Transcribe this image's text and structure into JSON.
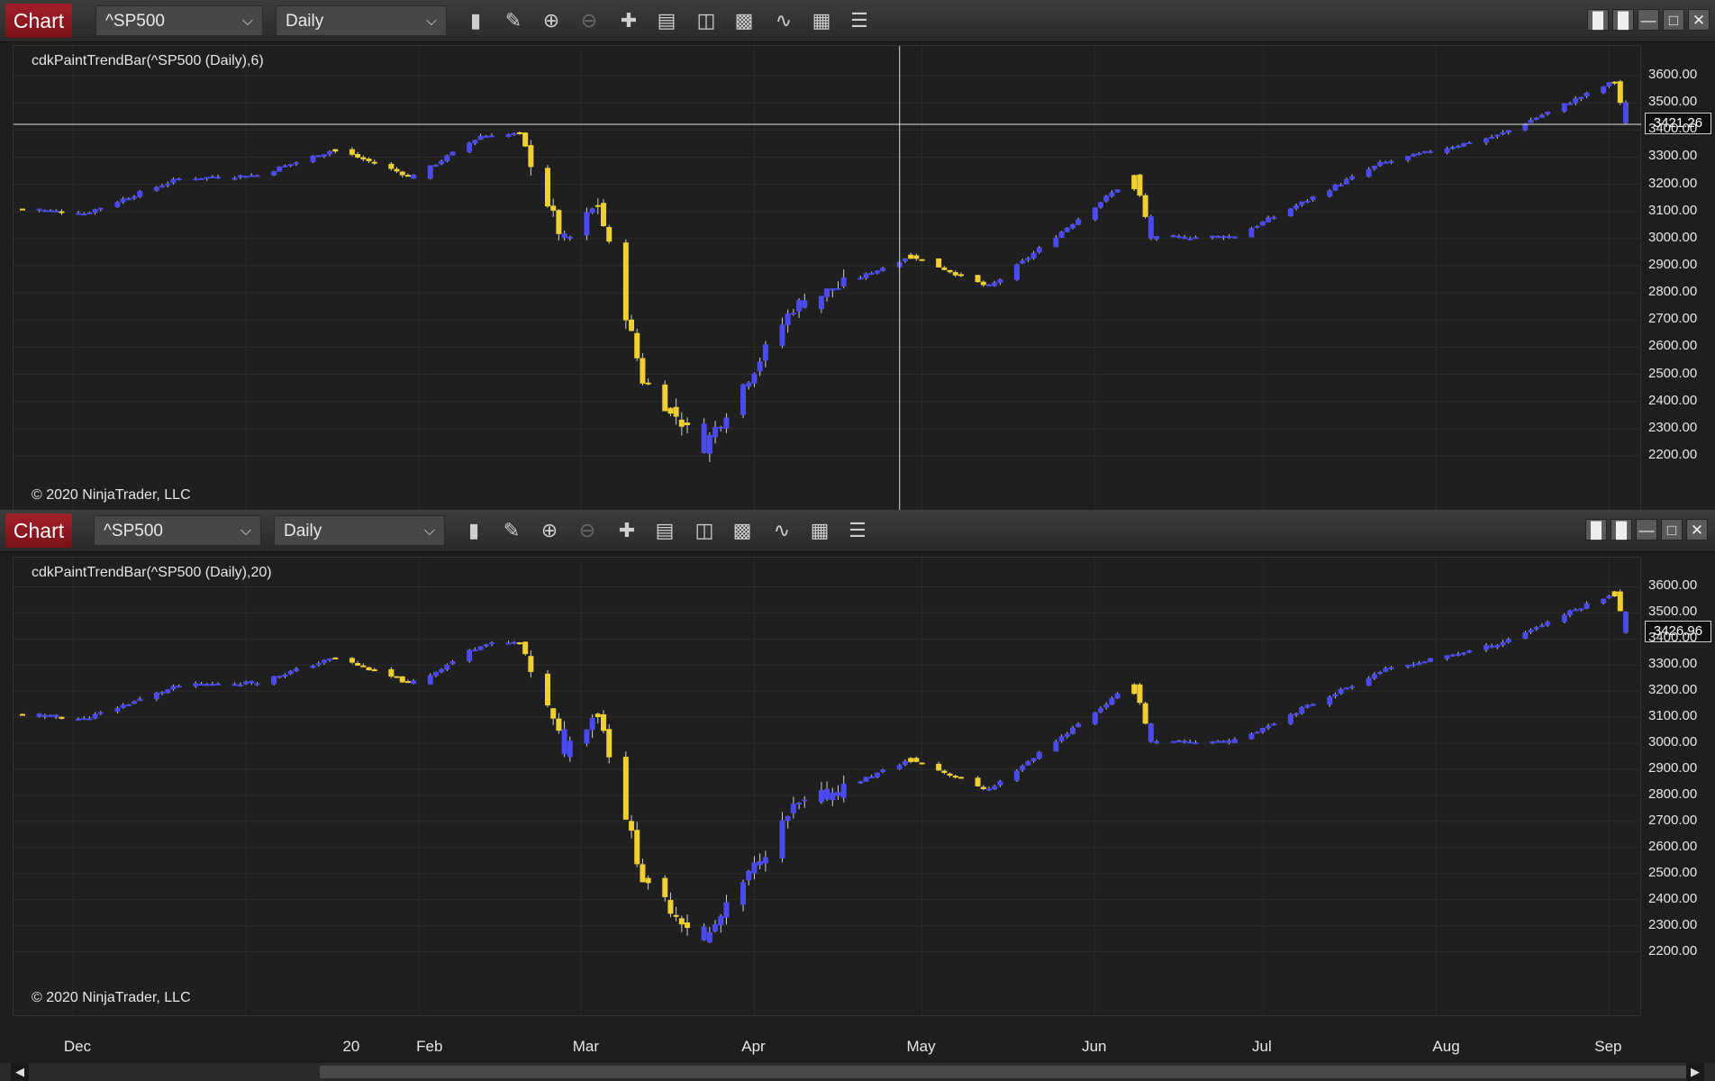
{
  "windows": [
    {
      "id": "top",
      "chart_tab": "Chart",
      "instrument": "^SP500",
      "interval": "Daily",
      "indicator_label": "cdkPaintTrendBar(^SP500 (Daily),6)",
      "copyright": "© 2020 NinjaTrader, LLC",
      "last_price": "3421.26",
      "y_ticks": [
        "3600.00",
        "3500.00",
        "3400.00",
        "3300.00",
        "3200.00",
        "3100.00",
        "3000.00",
        "2900.00",
        "2800.00",
        "2700.00",
        "2600.00",
        "2500.00",
        "2400.00",
        "2300.00",
        "2200.00"
      ]
    },
    {
      "id": "bottom",
      "chart_tab": "Chart",
      "instrument": "^SP500",
      "interval": "Daily",
      "indicator_label": "cdkPaintTrendBar(^SP500 (Daily),20)",
      "copyright": "© 2020 NinjaTrader, LLC",
      "last_price": "3426.96",
      "y_ticks": [
        "3600.00",
        "3500.00",
        "3400.00",
        "3300.00",
        "3200.00",
        "3100.00",
        "3000.00",
        "2900.00",
        "2800.00",
        "2700.00",
        "2600.00",
        "2500.00",
        "2400.00",
        "2300.00",
        "2200.00"
      ]
    }
  ],
  "x_axis_labels": [
    "Dec",
    "20",
    "Feb",
    "Mar",
    "Apr",
    "May",
    "Jun",
    "Jul",
    "Aug",
    "Sep"
  ],
  "toolbar_icons": [
    "bar-type-icon",
    "pencil-icon",
    "zoom-in-icon",
    "zoom-out-icon",
    "crosshair-icon",
    "data-box-icon",
    "template-icon",
    "strategies-icon",
    "indicators-icon",
    "properties-icon",
    "list-icon"
  ],
  "colors": {
    "up_trend": "#4a4af0",
    "down_trend": "#f0d030",
    "background": "#1f1f1f",
    "tab": "#9a1a24"
  },
  "chart_data": [
    {
      "type": "candlestick",
      "title": "cdkPaintTrendBar(^SP500 (Daily),6)",
      "ylim": [
        2150,
        3650
      ],
      "x_range": [
        "2019-11-22",
        "2020-09-04"
      ],
      "path_nodes": [
        {
          "date": "2019-11-22",
          "close": 3110
        },
        {
          "date": "2019-12-03",
          "close": 3093
        },
        {
          "date": "2019-12-20",
          "close": 3221
        },
        {
          "date": "2020-01-03",
          "close": 3234
        },
        {
          "date": "2020-01-17",
          "close": 3329
        },
        {
          "date": "2020-01-31",
          "close": 3225
        },
        {
          "date": "2020-02-12",
          "close": 3379
        },
        {
          "date": "2020-02-19",
          "close": 3386
        },
        {
          "date": "2020-02-27",
          "close": 2978
        },
        {
          "date": "2020-03-04",
          "close": 3130
        },
        {
          "date": "2020-03-12",
          "close": 2480
        },
        {
          "date": "2020-03-23",
          "close": 2237
        },
        {
          "date": "2020-04-08",
          "close": 2749
        },
        {
          "date": "2020-04-29",
          "close": 2939
        },
        {
          "date": "2020-05-13",
          "close": 2820
        },
        {
          "date": "2020-06-08",
          "close": 3232
        },
        {
          "date": "2020-06-11",
          "close": 3002
        },
        {
          "date": "2020-06-26",
          "close": 3009
        },
        {
          "date": "2020-07-22",
          "close": 3276
        },
        {
          "date": "2020-08-12",
          "close": 3380
        },
        {
          "date": "2020-09-02",
          "close": 3580
        },
        {
          "date": "2020-09-04",
          "close": 3421
        }
      ],
      "crosshair": {
        "date": "2020-04-27",
        "price": 3421
      }
    },
    {
      "type": "candlestick",
      "title": "cdkPaintTrendBar(^SP500 (Daily),20)",
      "ylim": [
        2150,
        3650
      ],
      "x_range": [
        "2019-11-22",
        "2020-09-04"
      ],
      "path_nodes": [
        {
          "date": "2019-11-22",
          "close": 3110
        },
        {
          "date": "2019-12-03",
          "close": 3093
        },
        {
          "date": "2019-12-20",
          "close": 3221
        },
        {
          "date": "2020-01-03",
          "close": 3234
        },
        {
          "date": "2020-01-17",
          "close": 3329
        },
        {
          "date": "2020-01-31",
          "close": 3225
        },
        {
          "date": "2020-02-12",
          "close": 3379
        },
        {
          "date": "2020-02-19",
          "close": 3386
        },
        {
          "date": "2020-02-27",
          "close": 2978
        },
        {
          "date": "2020-03-04",
          "close": 3130
        },
        {
          "date": "2020-03-12",
          "close": 2480
        },
        {
          "date": "2020-03-23",
          "close": 2237
        },
        {
          "date": "2020-04-08",
          "close": 2749
        },
        {
          "date": "2020-04-29",
          "close": 2939
        },
        {
          "date": "2020-05-13",
          "close": 2820
        },
        {
          "date": "2020-06-08",
          "close": 3232
        },
        {
          "date": "2020-06-11",
          "close": 3002
        },
        {
          "date": "2020-06-26",
          "close": 3009
        },
        {
          "date": "2020-07-22",
          "close": 3276
        },
        {
          "date": "2020-08-12",
          "close": 3380
        },
        {
          "date": "2020-09-02",
          "close": 3580
        },
        {
          "date": "2020-09-04",
          "close": 3426
        }
      ]
    }
  ]
}
